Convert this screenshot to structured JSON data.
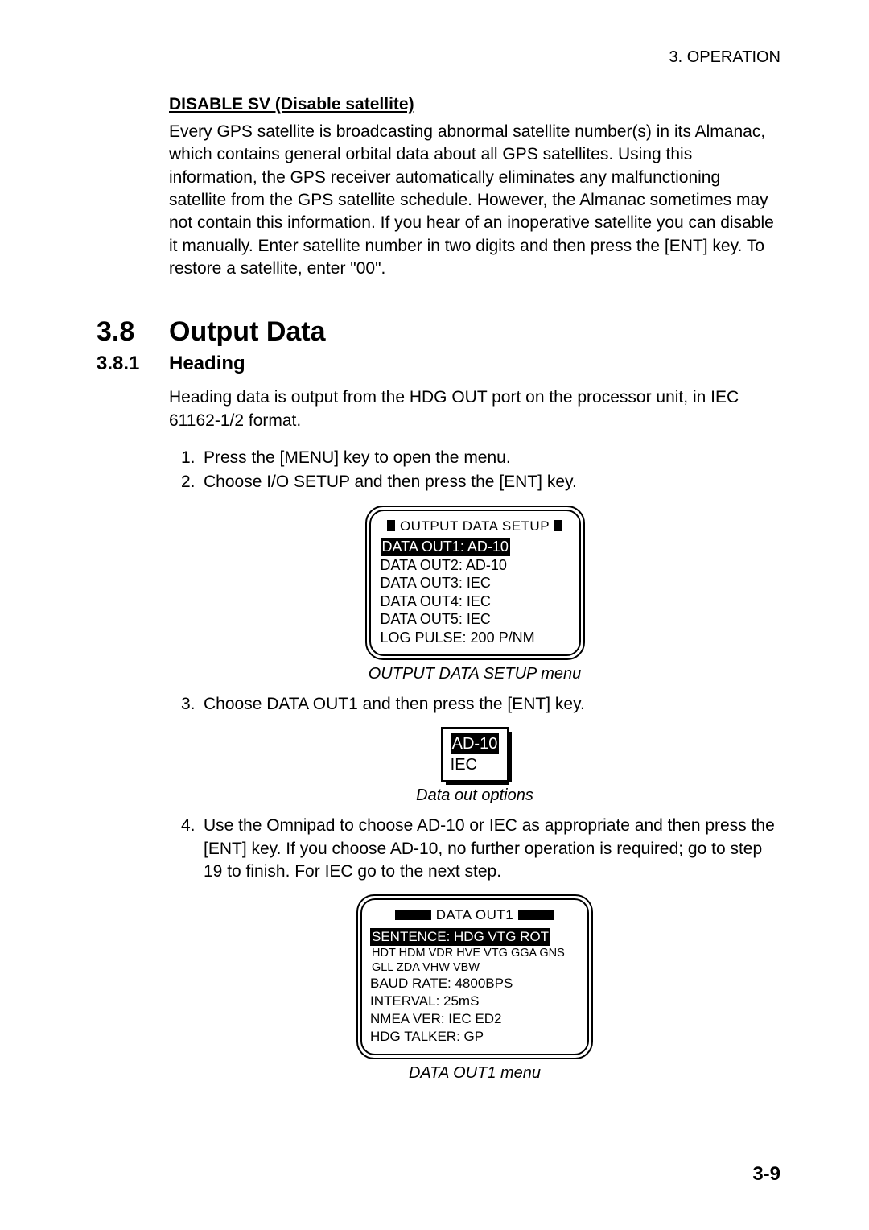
{
  "header": {
    "chapter": "3. OPERATION"
  },
  "disable": {
    "title": "DISABLE SV (Disable satellite)",
    "body": "Every GPS satellite is broadcasting abnormal satellite number(s) in its Almanac, which contains general orbital data about all GPS satellites. Using this information, the GPS receiver automatically eliminates any malfunctioning satellite from the GPS satellite schedule. However, the Almanac sometimes may not contain this information. If you hear of an inoperative satellite you can disable it manually. Enter satellite number in two digits and then press the [ENT] key. To restore a satellite, enter \"00\"."
  },
  "section": {
    "num": "3.8",
    "title": "Output Data"
  },
  "subsection": {
    "num": "3.8.1",
    "title": "Heading"
  },
  "heading_body": "Heading data is output from the HDG OUT port on the processor unit, in IEC 61162-1/2 format.",
  "steps": {
    "s1": "Press the [MENU] key to open the menu.",
    "s2": "Choose I/O SETUP and then press the [ENT] key.",
    "s3": "Choose DATA OUT1 and then press the [ENT] key.",
    "s4": "Use the Omnipad to choose AD-10 or IEC as appropriate and then press the [ENT] key. If you choose AD-10, no further operation is required; go to step 19 to finish. For IEC go to the next step."
  },
  "fig1": {
    "title": "OUTPUT DATA SETUP",
    "rows": {
      "r1": "DATA OUT1: AD-10",
      "r2": "DATA OUT2: AD-10",
      "r3": "DATA OUT3: IEC",
      "r4": "DATA OUT4: IEC",
      "r5": "DATA OUT5: IEC",
      "r6": "LOG PULSE: 200 P/NM"
    },
    "caption": "OUTPUT DATA SETUP menu"
  },
  "fig2": {
    "opt1": "AD-10",
    "opt2": "IEC",
    "caption": "Data out options"
  },
  "fig3": {
    "title": "DATA OUT1",
    "sel": "SENTENCE: HDG VTG ROT",
    "line1": "HDT HDM VDR HVE VTG GGA GNS",
    "line2": "GLL ZDA VHW VBW",
    "r3": "BAUD RATE: 4800BPS",
    "r4": "INTERVAL: 25mS",
    "r5": "NMEA VER: IEC ED2",
    "r6": "HDG TALKER: GP",
    "caption": "DATA OUT1 menu"
  },
  "page_num": "3-9"
}
